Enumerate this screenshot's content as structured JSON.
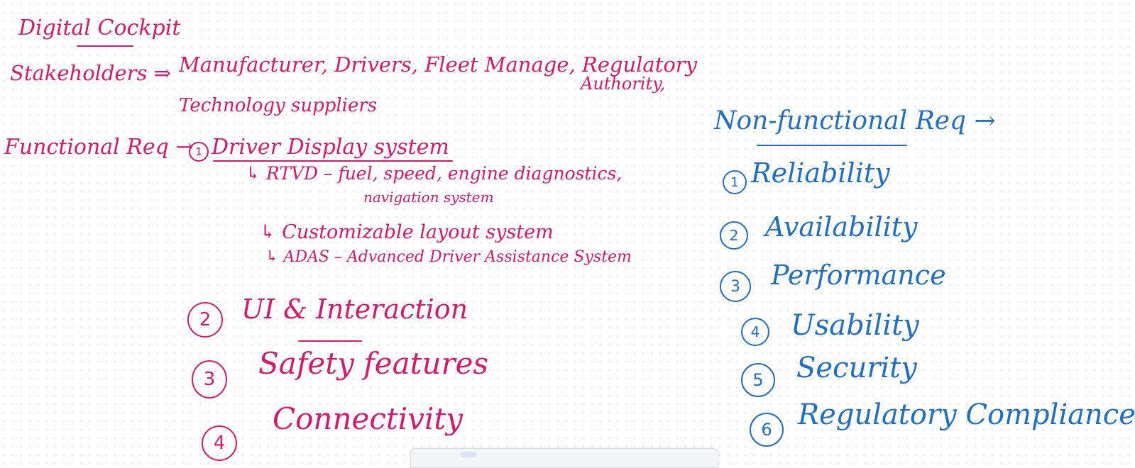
{
  "notes": {
    "title": "Digital Cockpit",
    "stakeholders_label": "Stakeholders ⇒",
    "stakeholders_list": "Manufacturer, Drivers, Fleet Manage, Regulatory",
    "stakeholders_cont1": "Authority,",
    "stakeholders_cont2": "Technology suppliers",
    "functional_label": "Functional Req →",
    "fr1_number": "1",
    "fr1_title": "Driver Display system",
    "fr1_sub1": "↳ RTVD – fuel, speed, engine diagnostics,",
    "fr1_sub1_cont": "navigation system",
    "fr1_sub2": "↳ Customizable layout system",
    "fr1_sub3": "↳ ADAS – Advanced Driver Assistance System",
    "fr2_number": "2",
    "fr2_title": "UI & Interaction",
    "fr3_number": "3",
    "fr3_title": "Safety features",
    "fr4_number": "4",
    "fr4_title": "Connectivity",
    "nfr_label": "Non-functional Req →",
    "nfr_items": [
      {
        "num": "1",
        "label": "Reliability"
      },
      {
        "num": "2",
        "label": "Availability"
      },
      {
        "num": "3",
        "label": "Performance"
      },
      {
        "num": "4",
        "label": "Usability"
      },
      {
        "num": "5",
        "label": "Security"
      },
      {
        "num": "6",
        "label": "Regulatory Compliance"
      }
    ]
  },
  "colors": {
    "pink_ink": "#d6196c",
    "blue_ink": "#1f6fc5",
    "canvas_bg": "#ffffff",
    "dot_grid": "#d9dde3"
  },
  "toolbar": {
    "tools": [
      {
        "icon": "hand-icon"
      },
      {
        "icon": "pointer-icon"
      },
      {
        "icon": "pen-icon"
      },
      {
        "icon": "highlighter-icon"
      },
      {
        "icon": "eraser-icon"
      },
      {
        "icon": "shape-icon"
      },
      {
        "icon": "image-icon"
      },
      {
        "icon": "more-icon"
      }
    ]
  }
}
